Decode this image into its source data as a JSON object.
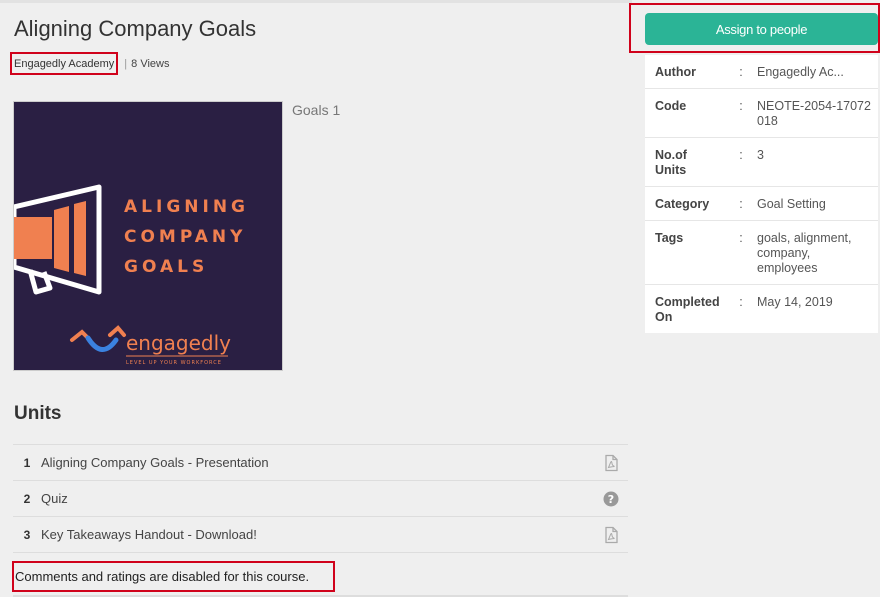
{
  "course": {
    "title": "Aligning Company Goals",
    "academy": "Engagedly Academy",
    "separator": "|",
    "views": "8 Views",
    "unit_caption": "Goals 1"
  },
  "thumbnail": {
    "headline": [
      "ALIGNING",
      "COMPANY",
      "GOALS"
    ],
    "brand": "engagedly",
    "tagline": "LEVEL UP YOUR WORKFORCE",
    "colors": {
      "background": "#2a1f43",
      "accent": "#f08050"
    }
  },
  "units": {
    "heading": "Units",
    "items": [
      {
        "num": "1",
        "name": "Aligning Company Goals - Presentation",
        "icon": "pdf-icon"
      },
      {
        "num": "2",
        "name": "Quiz",
        "icon": "help-icon"
      },
      {
        "num": "3",
        "name": "Key Takeaways Handout - Download!",
        "icon": "pdf-icon"
      }
    ]
  },
  "comments_notice": "Comments and ratings are disabled for this course.",
  "sidebar": {
    "assign_label": "Assign to people",
    "colon": ":",
    "details": [
      {
        "label": "Author",
        "value": "Engagedly Ac..."
      },
      {
        "label": "Code",
        "value": "NEOTE-2054-17072018"
      },
      {
        "label": "No.of Units",
        "value": "3"
      },
      {
        "label": "Category",
        "value": "Goal Setting"
      },
      {
        "label": "Tags",
        "value": "goals, alignment, company, employees"
      },
      {
        "label": "Completed On",
        "value": "May 14, 2019"
      }
    ]
  },
  "colors": {
    "accent": "#2bb496",
    "highlight": "#d0021b"
  }
}
